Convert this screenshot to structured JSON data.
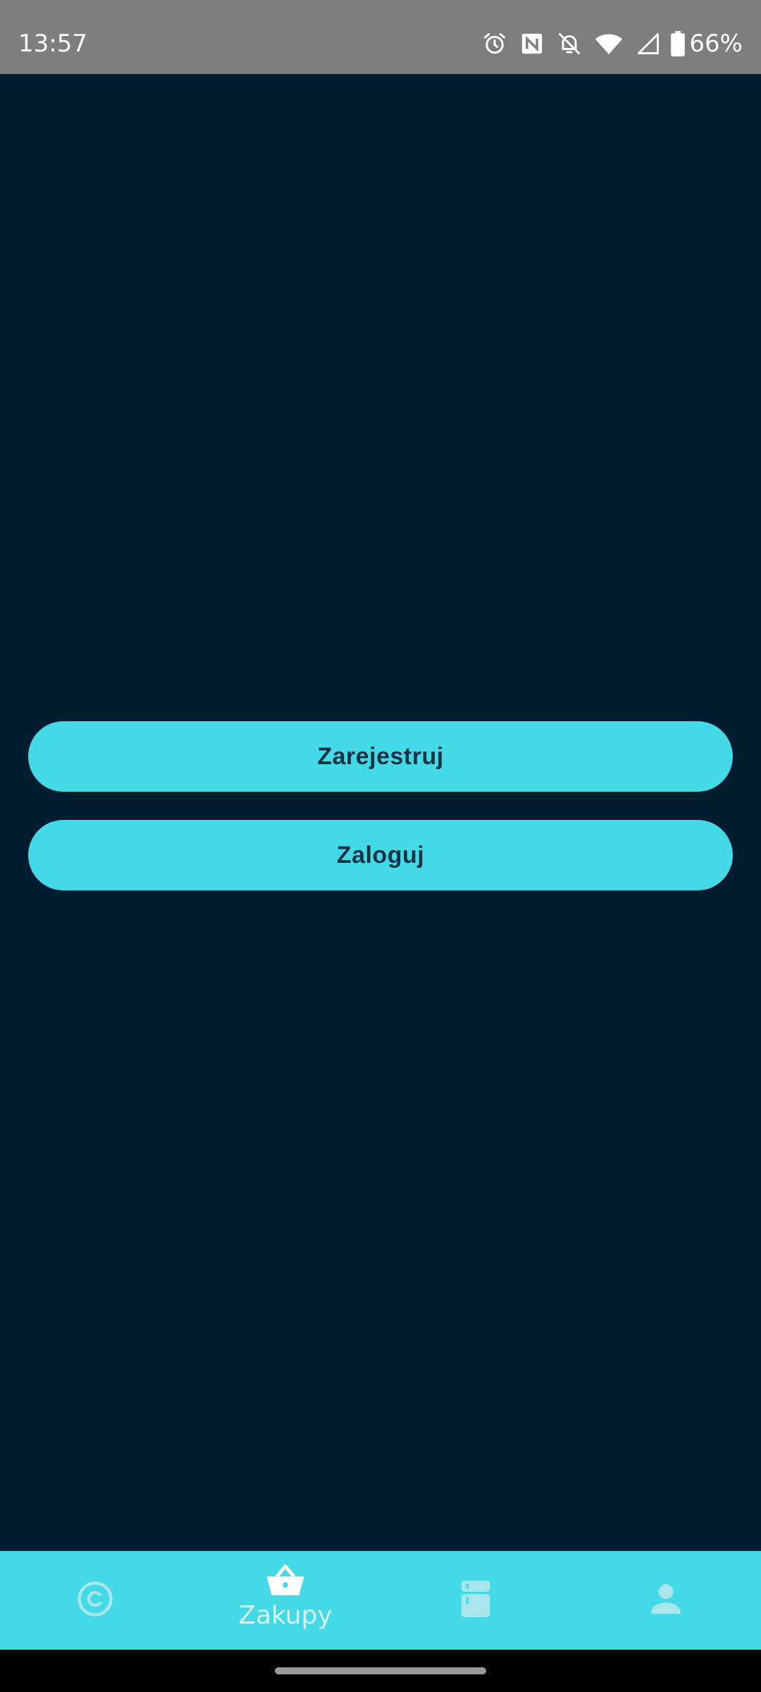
{
  "status_bar": {
    "time": "13:57",
    "battery_percent": "66%",
    "icons": [
      "alarm-icon",
      "nfc-icon",
      "notifications-off-icon",
      "wifi-icon",
      "cell-signal-icon",
      "battery-icon"
    ]
  },
  "main": {
    "register_label": "Zarejestruj",
    "login_label": "Zaloguj"
  },
  "bottom_nav": {
    "items": [
      {
        "icon": "copyright-icon",
        "label": ""
      },
      {
        "icon": "basket-icon",
        "label": "Zakupy",
        "active": true
      },
      {
        "icon": "fridge-icon",
        "label": ""
      },
      {
        "icon": "person-icon",
        "label": ""
      }
    ]
  },
  "colors": {
    "background": "#021d2f",
    "accent": "#43d9e7",
    "button_text": "#0e3345",
    "status_bar": "#7e7e7e"
  }
}
